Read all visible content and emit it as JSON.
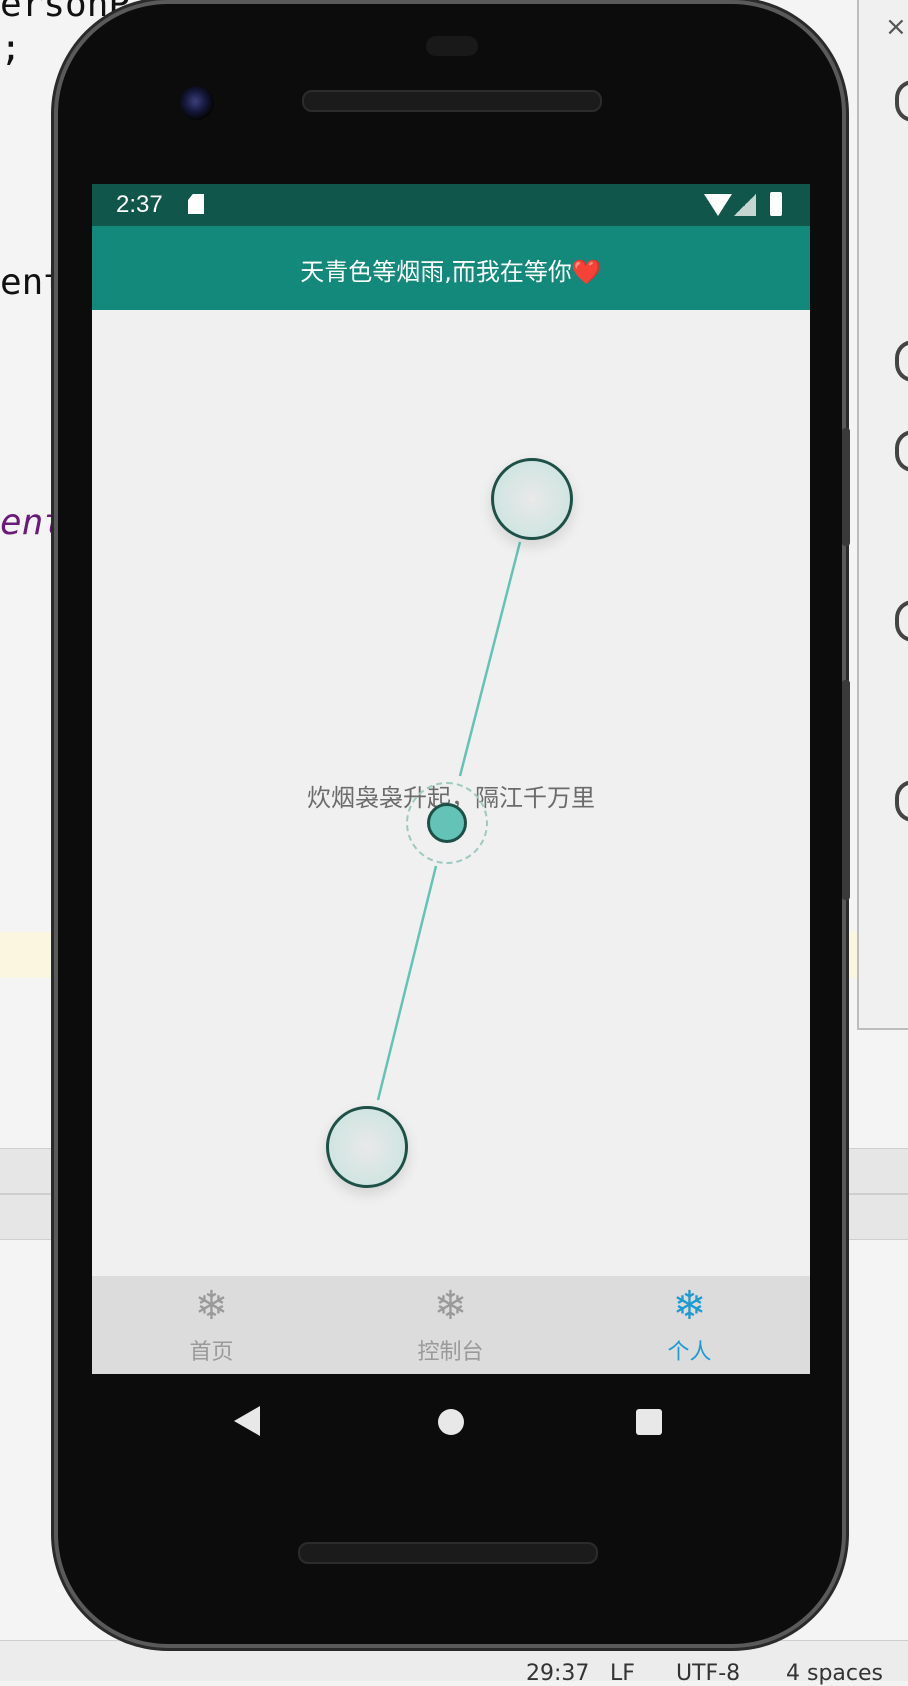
{
  "ide": {
    "code_fragments": [
      "ersonP",
      ";",
      "ent",
      "ent"
    ],
    "right_panel_close": "×",
    "status": {
      "position": "29:37",
      "line_sep": "LF",
      "encoding": "UTF-8",
      "indent": "4 spaces"
    }
  },
  "device": {
    "status_bar": {
      "time": "2:37"
    },
    "app_bar": {
      "title": "天青色等烟雨,而我在等你❤️"
    },
    "content": {
      "center_text": "炊烟袅袅升起，隔江千万里",
      "line_color": "#62c3b6",
      "node_border_color": "#1e5048"
    },
    "bottom_nav": {
      "items": [
        {
          "label": "首页",
          "icon": "snowflake-icon",
          "active": false
        },
        {
          "label": "控制台",
          "icon": "snowflake-icon",
          "active": false
        },
        {
          "label": "个人",
          "icon": "snowflake-icon",
          "active": true
        }
      ],
      "active_color": "#1d9bd3",
      "inactive_color": "#9a9a9a"
    },
    "colors": {
      "app_bar": "#12897a",
      "status_bar": "#11564b"
    }
  }
}
